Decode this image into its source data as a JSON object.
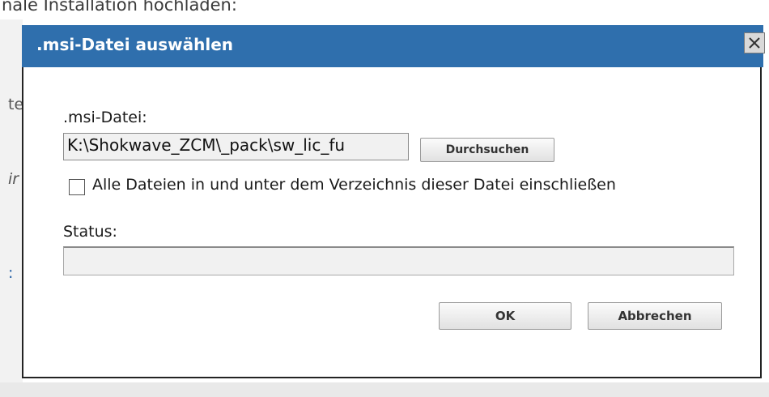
{
  "background": {
    "heading": "nale Installation hochladen:",
    "fragments": [
      "te",
      "ir",
      ":"
    ]
  },
  "dialog": {
    "title": ".msi-Datei auswählen",
    "msi_label": ".msi-Datei:",
    "msi_value": "K:\\Shokwave_ZCM\\_pack\\sw_lic_fu",
    "browse_label": "Durchsuchen",
    "include_checkbox_label": "Alle Dateien in und unter dem Verzeichnis dieser Datei einschließen",
    "include_checked": false,
    "status_label": "Status:",
    "status_value": "",
    "ok_label": "OK",
    "cancel_label": "Abbrechen"
  },
  "colors": {
    "titlebar": "#2f6fad",
    "title_text": "#ffffff",
    "link": "#2a63a8"
  },
  "icons": {
    "close": "close-icon"
  }
}
